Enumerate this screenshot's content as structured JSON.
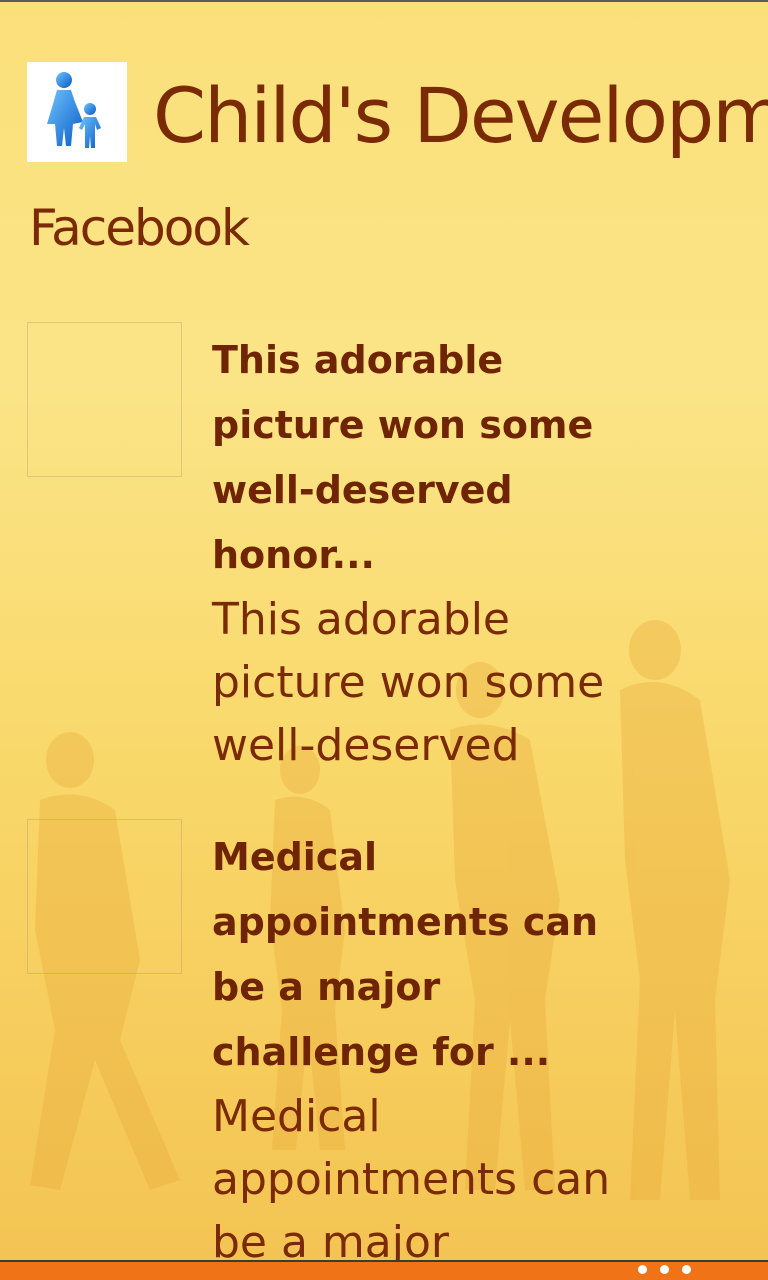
{
  "header": {
    "title": "Child's Development",
    "logo_icon": "parent-child-icon"
  },
  "section": {
    "title": "Facebook"
  },
  "feed": {
    "items": [
      {
        "headline": "This adorable picture won some well-deserved honor...",
        "summary": "This adorable picture won some well-deserved"
      },
      {
        "headline": "Medical appointments can be a major challenge for ...",
        "summary": "Medical appointments can be a major"
      }
    ]
  },
  "app_bar": {
    "more_icon": "ellipsis-icon"
  },
  "colors": {
    "text": "#7a2a05",
    "background": "#fbe07a",
    "app_bar": "#f07318"
  }
}
